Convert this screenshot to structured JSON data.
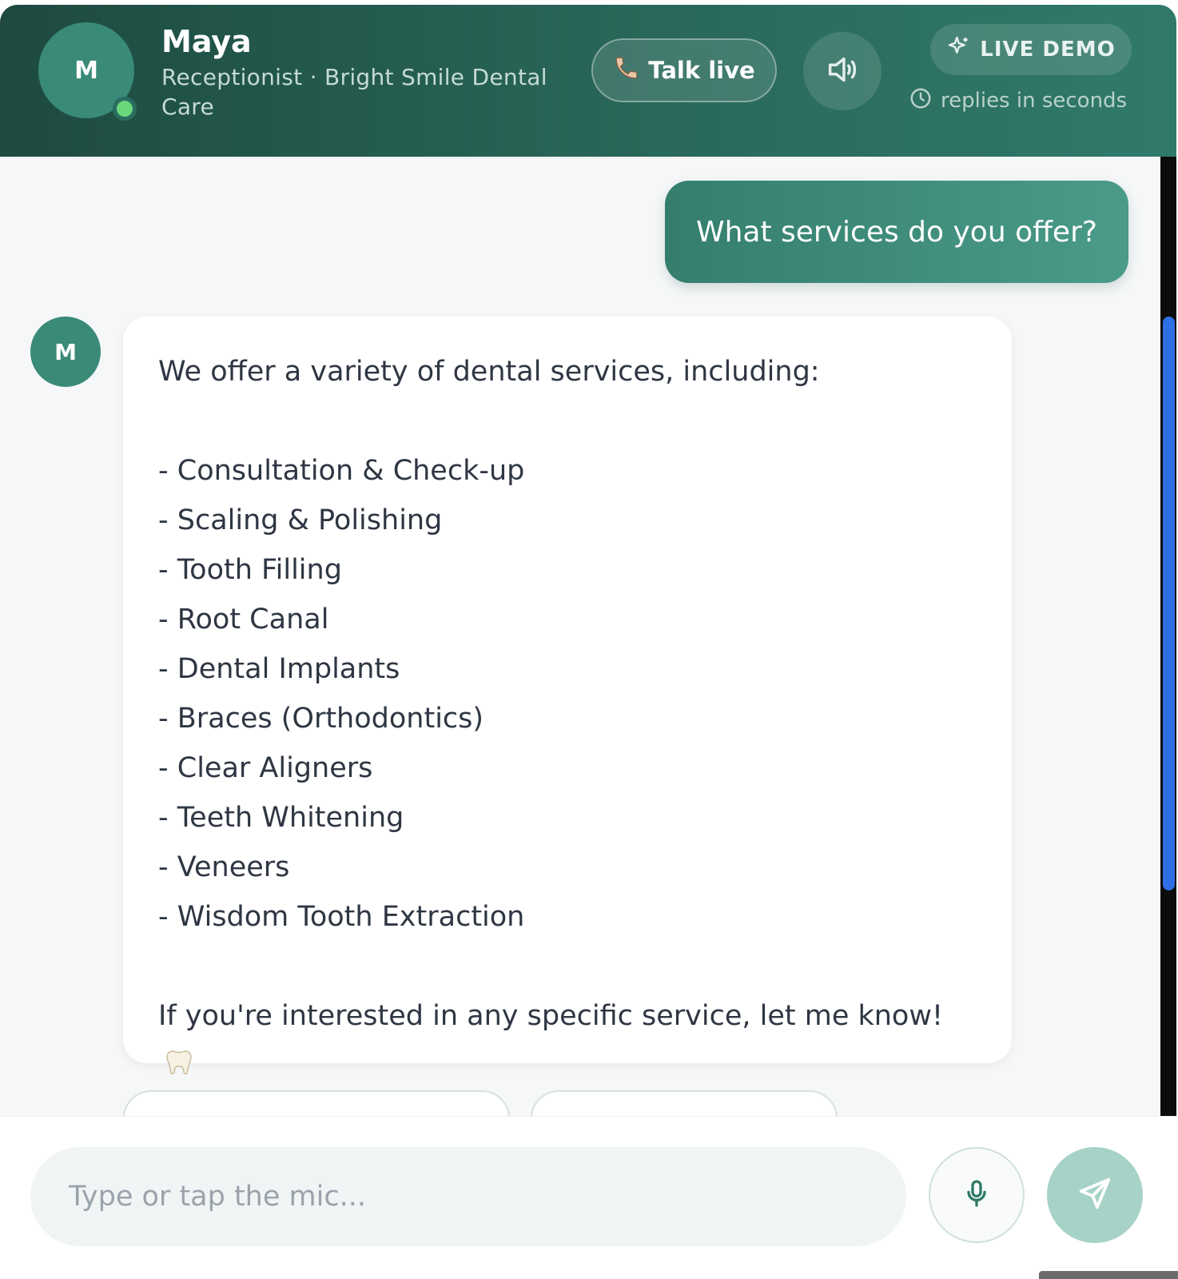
{
  "header": {
    "avatar_initial": "M",
    "name": "Maya",
    "role": "Receptionist · Bright Smile Dental Care",
    "talk_live_label": "Talk live",
    "demo_badge": "LIVE DEMO",
    "reply_speed": "replies in seconds"
  },
  "messages": {
    "user": "What services do you offer?",
    "bot_avatar_initial": "M",
    "bot_intro": "We offer a variety of dental services, including:",
    "bot_services": [
      "- Consultation & Check-up",
      "- Scaling & Polishing",
      "- Tooth Filling",
      "- Root Canal",
      "- Dental Implants",
      "- Braces (Orthodontics)",
      "- Clear Aligners",
      "- Teeth Whitening",
      "- Veneers",
      "- Wisdom Tooth Extraction"
    ],
    "bot_outro": "If you're interested in any specific service, let me know!"
  },
  "composer": {
    "placeholder": "Type or tap the mic..."
  },
  "colors": {
    "header_dark": "#1e4a40",
    "header_light": "#317a6b",
    "accent": "#3a8a78",
    "online": "#6bd67c",
    "send_disabled": "#a7d2c7",
    "scrollbar": "#2f6fe6"
  },
  "icons": {
    "talk": "phone-icon",
    "speaker": "speaker-icon",
    "demo": "sparkle-icon",
    "clock": "clock-icon",
    "mic": "mic-icon",
    "send": "send-icon",
    "emoji": "tooth-emoji"
  }
}
